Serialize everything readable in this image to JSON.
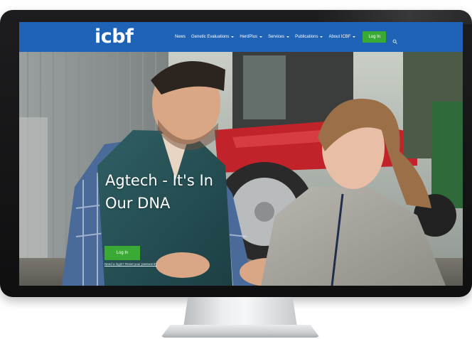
{
  "site": {
    "logo_text": "icbf",
    "brand_color": "#1e63b6",
    "accent_color": "#3aaa35"
  },
  "nav": {
    "items": [
      {
        "label": "News",
        "has_dropdown": false
      },
      {
        "label": "Genetic Evaluations",
        "has_dropdown": true
      },
      {
        "label": "HerdPlus",
        "has_dropdown": true
      },
      {
        "label": "Services",
        "has_dropdown": true
      },
      {
        "label": "Publications",
        "has_dropdown": true
      },
      {
        "label": "About ICBF",
        "has_dropdown": true
      }
    ],
    "login_label": "Log In",
    "search_icon": "search-icon"
  },
  "hero": {
    "title_line1": "Agtech - It's In",
    "title_line2": "Our DNA",
    "login_label": "Log In",
    "link_text": "Need a login? Reset your password?"
  }
}
